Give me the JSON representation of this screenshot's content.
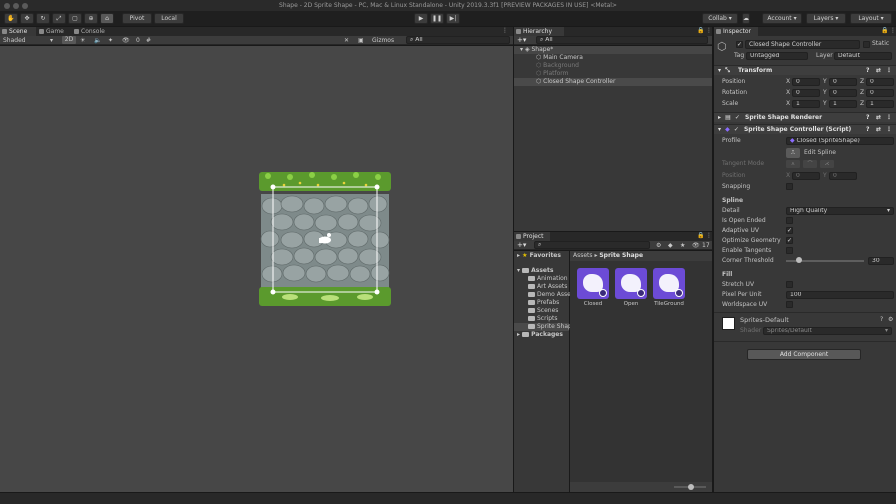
{
  "window": {
    "title": "Shape - 2D Sprite Shape - PC, Mac & Linux Standalone - Unity 2019.3.3f1 [PREVIEW PACKAGES IN USE] <Metal>"
  },
  "toolbar": {
    "pivot": "Pivot",
    "local": "Local",
    "collab": "Collab",
    "account": "Account",
    "layers": "Layers",
    "layout": "Layout"
  },
  "scene_tabs": {
    "scene": "Scene",
    "game": "Game",
    "console": "Console"
  },
  "scene_bar": {
    "shading": "Shaded",
    "mode_2d": "2D",
    "fx_count": "0",
    "gizmos": "Gizmos",
    "search": "All"
  },
  "hierarchy": {
    "tab": "Hierarchy",
    "search": "All",
    "root": "Shape*",
    "items": [
      "Main Camera",
      "Background",
      "Platform",
      "Closed Shape Controller"
    ]
  },
  "project": {
    "tab": "Project",
    "count": "17",
    "breadcrumb": [
      "Assets",
      "Sprite Shape"
    ],
    "favorites": "Favorites",
    "assets_root": "Assets",
    "folders": [
      "Animation",
      "Art Assets",
      "Demo Asse",
      "Prefabs",
      "Scenes",
      "Scripts",
      "Sprite Shap"
    ],
    "packages": "Packages",
    "assets": [
      "Closed",
      "Open",
      "TileGround"
    ]
  },
  "inspector": {
    "tab": "Inspector",
    "object_name": "Closed Shape Controller",
    "static_label": "Static",
    "tag_label": "Tag",
    "tag_value": "Untagged",
    "layer_label": "Layer",
    "layer_value": "Default",
    "transform": {
      "header": "Transform",
      "position_label": "Position",
      "rotation_label": "Rotation",
      "scale_label": "Scale",
      "position": [
        "0",
        "0",
        "0"
      ],
      "rotation": [
        "0",
        "0",
        "0"
      ],
      "scale": [
        "1",
        "1",
        "1"
      ]
    },
    "renderer_header": "Sprite Shape Renderer",
    "controller": {
      "header": "Sprite Shape Controller (Script)",
      "profile_label": "Profile",
      "profile_value": "Closed (SpriteShape)",
      "edit_spline": "Edit Spline",
      "tangent_mode": "Tangent Mode",
      "position_label": "Position",
      "pos_x": "0",
      "pos_y": "0",
      "snapping": "Snapping",
      "spline_section": "Spline",
      "detail_label": "Detail",
      "detail_value": "High Quality",
      "is_open_ended": "Is Open Ended",
      "adaptive_uv": "Adaptive UV",
      "optimize_geometry": "Optimize Geometry",
      "enable_tangents": "Enable Tangents",
      "corner_threshold": "Corner Threshold",
      "corner_threshold_value": "30",
      "corner_threshold_fraction": 0.17,
      "fill_section": "Fill",
      "stretch_uv": "Stretch UV",
      "pixel_per_unit": "Pixel Per Unit",
      "pixel_per_unit_value": "100",
      "worldspace_uv": "Worldspace UV"
    },
    "material": {
      "name": "Sprites-Default",
      "shader_label": "Shader",
      "shader_value": "Sprites/Default"
    },
    "add_component": "Add Component"
  },
  "colors": {
    "accent": "#6c4bd6",
    "selection": "#4a4a4a",
    "panel": "#383838",
    "scene_bg": "#474747"
  }
}
